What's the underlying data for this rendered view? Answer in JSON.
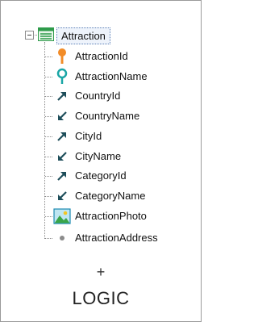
{
  "tree": {
    "root": {
      "label": "Attraction",
      "icon": "transaction-table-icon",
      "expanded": true
    },
    "items": [
      {
        "label": "AttractionId",
        "icon": "primary-key-icon"
      },
      {
        "label": "AttractionName",
        "icon": "description-key-icon"
      },
      {
        "label": "CountryId",
        "icon": "foreign-key-icon"
      },
      {
        "label": "CountryName",
        "icon": "inferred-attribute-icon"
      },
      {
        "label": "CityId",
        "icon": "foreign-key-icon"
      },
      {
        "label": "CityName",
        "icon": "inferred-attribute-icon"
      },
      {
        "label": "CategoryId",
        "icon": "foreign-key-icon"
      },
      {
        "label": "CategoryName",
        "icon": "inferred-attribute-icon"
      },
      {
        "label": "AttractionPhoto",
        "icon": "image-icon"
      },
      {
        "label": "AttractionAddress",
        "icon": "attribute-dot-icon"
      }
    ]
  },
  "caption": {
    "plus": "+",
    "text": "LOGIC"
  },
  "colors": {
    "key": "#f28c28",
    "description_key": "#1aa6a6",
    "relation_arrow": "#1e4e5a",
    "root_icon": "#2e9b4a"
  }
}
